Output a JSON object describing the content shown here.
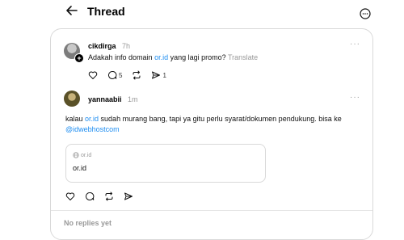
{
  "header": {
    "title": "Thread"
  },
  "post": {
    "username": "cikdirga",
    "time": "7h",
    "text_before": "Adakah info domain ",
    "text_link": "or.id",
    "text_after": " yang lagi promo?",
    "translate_label": "Translate",
    "reply_count": "5",
    "share_count": "1"
  },
  "reply": {
    "username": "yannaabii",
    "time": "1m",
    "text_before": "kalau ",
    "text_link": "or.id",
    "text_after": " sudah murang bang, tapi ya gitu perlu syarat/dokumen pendukung. bisa ke ",
    "mention": "@idwebhostcom",
    "preview_domain": "or.id",
    "preview_title": "or.id"
  },
  "footer": {
    "no_replies": "No replies yet"
  },
  "icons": {
    "back": "arrow-left-icon",
    "more": "more-circle-icon",
    "like": "heart-icon",
    "comment": "comment-icon",
    "repost": "repost-icon",
    "share": "send-icon",
    "globe": "globe-icon"
  }
}
